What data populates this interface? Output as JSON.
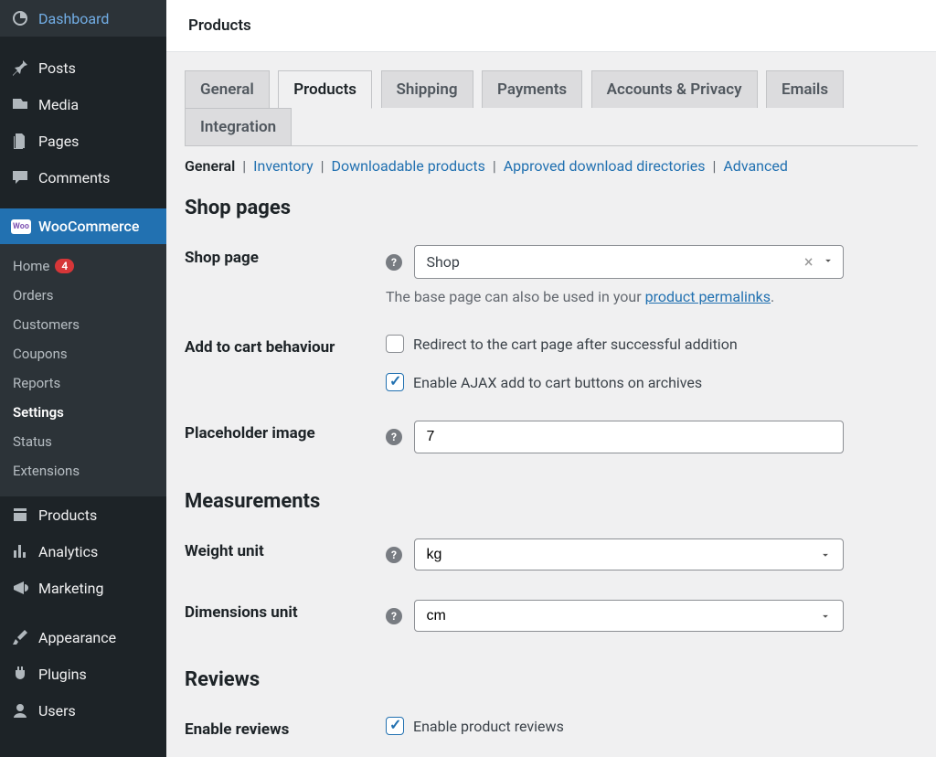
{
  "header": {
    "title": "Products"
  },
  "sidebar": {
    "items": [
      {
        "label": "Dashboard",
        "icon": "dashboard"
      },
      {
        "label": "Posts",
        "icon": "pin"
      },
      {
        "label": "Media",
        "icon": "media"
      },
      {
        "label": "Pages",
        "icon": "pages"
      },
      {
        "label": "Comments",
        "icon": "comment"
      },
      {
        "label": "WooCommerce",
        "icon": "woo",
        "current": true
      },
      {
        "label": "Products",
        "icon": "products"
      },
      {
        "label": "Analytics",
        "icon": "analytics"
      },
      {
        "label": "Marketing",
        "icon": "marketing"
      },
      {
        "label": "Appearance",
        "icon": "brush"
      },
      {
        "label": "Plugins",
        "icon": "plugin"
      },
      {
        "label": "Users",
        "icon": "user"
      }
    ],
    "submenu": [
      {
        "label": "Home",
        "badge": "4"
      },
      {
        "label": "Orders"
      },
      {
        "label": "Customers"
      },
      {
        "label": "Coupons"
      },
      {
        "label": "Reports"
      },
      {
        "label": "Settings",
        "active": true
      },
      {
        "label": "Status"
      },
      {
        "label": "Extensions"
      }
    ]
  },
  "tabs": [
    {
      "label": "General"
    },
    {
      "label": "Products",
      "active": true
    },
    {
      "label": "Shipping"
    },
    {
      "label": "Payments"
    },
    {
      "label": "Accounts & Privacy"
    },
    {
      "label": "Emails"
    },
    {
      "label": "Integration"
    }
  ],
  "subnav": [
    {
      "label": "General",
      "current": true
    },
    {
      "label": "Inventory"
    },
    {
      "label": "Downloadable products"
    },
    {
      "label": "Approved download directories"
    },
    {
      "label": "Advanced"
    }
  ],
  "sections": {
    "shop_pages": {
      "title": "Shop pages",
      "shop_page_label": "Shop page",
      "shop_page_value": "Shop",
      "shop_page_help_pre": "The base page can also be used in your ",
      "shop_page_help_link": "product permalinks",
      "add_to_cart_label": "Add to cart behaviour",
      "cb_redirect_label": "Redirect to the cart page after successful addition",
      "cb_ajax_label": "Enable AJAX add to cart buttons on archives",
      "cb_redirect_checked": false,
      "cb_ajax_checked": true,
      "placeholder_label": "Placeholder image",
      "placeholder_value": "7"
    },
    "measurements": {
      "title": "Measurements",
      "weight_label": "Weight unit",
      "weight_value": "kg",
      "dimensions_label": "Dimensions unit",
      "dimensions_value": "cm"
    },
    "reviews": {
      "title": "Reviews",
      "enable_label": "Enable reviews",
      "cb_enable_label": "Enable product reviews",
      "cb_enable_checked": true
    }
  }
}
